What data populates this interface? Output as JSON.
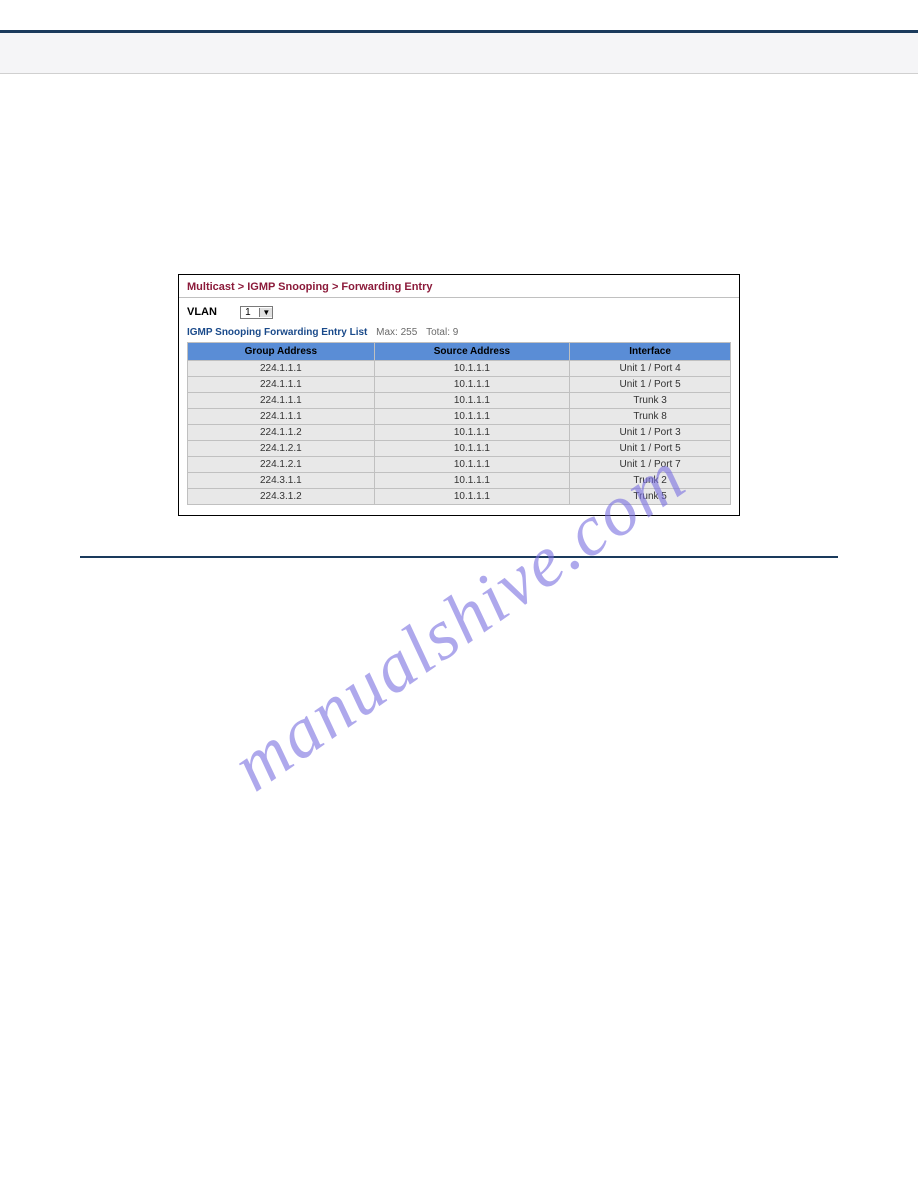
{
  "breadcrumb": "Multicast > IGMP Snooping > Forwarding Entry",
  "vlan": {
    "label": "VLAN",
    "value": "1"
  },
  "list": {
    "title": "IGMP Snooping Forwarding Entry List",
    "max_label": "Max: 255",
    "total_label": "Total: 9",
    "columns": [
      "Group Address",
      "Source Address",
      "Interface"
    ],
    "rows": [
      {
        "group": "224.1.1.1",
        "source": "10.1.1.1",
        "iface": "Unit 1 / Port 4"
      },
      {
        "group": "224.1.1.1",
        "source": "10.1.1.1",
        "iface": "Unit 1 / Port 5"
      },
      {
        "group": "224.1.1.1",
        "source": "10.1.1.1",
        "iface": "Trunk 3"
      },
      {
        "group": "224.1.1.1",
        "source": "10.1.1.1",
        "iface": "Trunk 8"
      },
      {
        "group": "224.1.1.2",
        "source": "10.1.1.1",
        "iface": "Unit 1 / Port 3"
      },
      {
        "group": "224.1.2.1",
        "source": "10.1.1.1",
        "iface": "Unit 1 / Port 5"
      },
      {
        "group": "224.1.2.1",
        "source": "10.1.1.1",
        "iface": "Unit 1 / Port 7"
      },
      {
        "group": "224.3.1.1",
        "source": "10.1.1.1",
        "iface": "Trunk 2"
      },
      {
        "group": "224.3.1.2",
        "source": "10.1.1.1",
        "iface": "Trunk 5"
      }
    ]
  },
  "watermark": "manualshive.com"
}
